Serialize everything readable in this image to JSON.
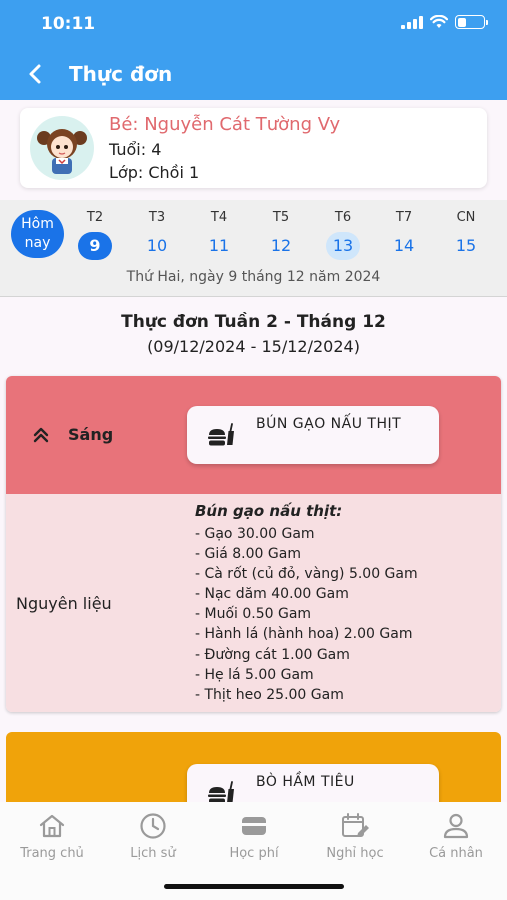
{
  "status_bar": {
    "time": "10:11"
  },
  "header": {
    "title": "Thực đơn"
  },
  "child": {
    "name": "Bé: Nguyễn Cát Tường  Vy",
    "age": "Tuổi: 4",
    "class": "Lớp: Chồi 1"
  },
  "week": {
    "today_label": "Hôm nay",
    "days": [
      {
        "name": "T2",
        "num": "9"
      },
      {
        "name": "T3",
        "num": "10"
      },
      {
        "name": "T4",
        "num": "11"
      },
      {
        "name": "T5",
        "num": "12"
      },
      {
        "name": "T6",
        "num": "13"
      },
      {
        "name": "T7",
        "num": "14"
      },
      {
        "name": "CN",
        "num": "15"
      }
    ],
    "selected_date": "Thứ Hai, ngày 9 tháng 12 năm 2024"
  },
  "menu": {
    "title": "Thực đơn Tuần 2 - Tháng 12",
    "range": "(09/12/2024 - 15/12/2024)",
    "meals": [
      {
        "label": "Sáng",
        "dish": "BÚN GẠO NẤU THỊT",
        "color": "#e8737a",
        "ingredients_label": "Nguyên liệu",
        "ingredients_title": "Bún gạo nấu thịt:",
        "ingredients": [
          "- Gạo 30.00 Gam",
          "- Giá 8.00 Gam",
          "- Cà rốt (củ đỏ, vàng) 5.00 Gam",
          "- Nạc dăm 40.00 Gam",
          "- Muối 0.50 Gam",
          "- Hành lá (hành hoa) 2.00 Gam",
          "- Đường cát 1.00 Gam",
          "- Hẹ lá 5.00 Gam",
          "- Thịt heo 25.00 Gam"
        ]
      },
      {
        "dish": "BÒ HẦM TIÊU",
        "color": "#f0a30a"
      }
    ]
  },
  "tabbar": {
    "items": [
      {
        "label": "Trang chủ",
        "icon": "home-icon"
      },
      {
        "label": "Lịch sử",
        "icon": "clock-icon"
      },
      {
        "label": "Học phí",
        "icon": "wallet-icon"
      },
      {
        "label": "Nghỉ học",
        "icon": "calendar-edit-icon"
      },
      {
        "label": "Cá nhân",
        "icon": "person-icon"
      }
    ]
  },
  "colors": {
    "primary": "#3d9ff0",
    "accent": "#1a73e8",
    "child_name": "#e0696e"
  }
}
